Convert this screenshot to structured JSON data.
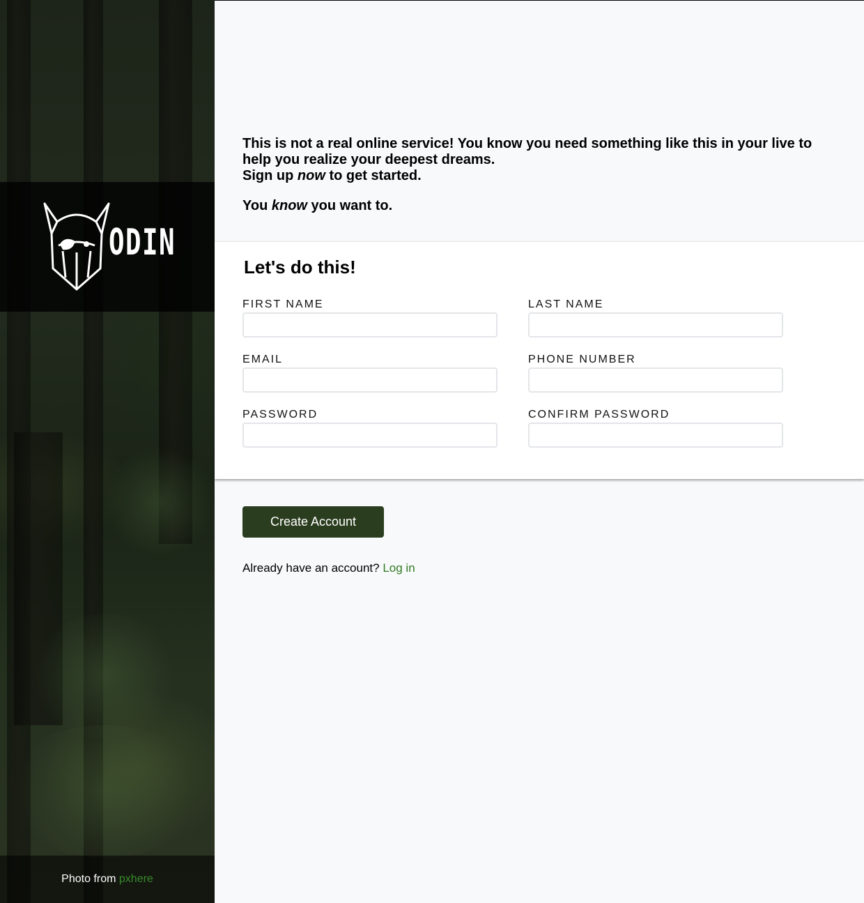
{
  "sidebar": {
    "logo_text": "ODIN",
    "credit_text": "Photo from",
    "credit_link": "pxhere"
  },
  "intro": {
    "line1": "This is not a real online service! You know you need something like this in your live to help you realize your deepest dreams.",
    "line2_pre": "Sign up ",
    "line2_em": "now",
    "line2_post": " to get started.",
    "line3_pre": "You ",
    "line3_em": "know",
    "line3_post": " you want to."
  },
  "form": {
    "title": "Let's do this!",
    "first_name_label": "FIRST NAME",
    "last_name_label": "LAST NAME",
    "email_label": "EMAIL",
    "phone_label": "PHONE NUMBER",
    "password_label": "PASSWORD",
    "confirm_password_label": "CONFIRM PASSWORD",
    "first_name_value": "",
    "last_name_value": "",
    "email_value": "",
    "phone_value": "",
    "password_value": "",
    "confirm_password_value": ""
  },
  "actions": {
    "create_label": "Create Account",
    "login_prompt": "Already have an account?",
    "login_link": "Log in"
  },
  "colors": {
    "button": "#2b3d1f",
    "link": "#2f7a22",
    "credit_link": "#3a8b2f"
  },
  "icons": {
    "logo": "viking-helmet-logo-icon"
  }
}
